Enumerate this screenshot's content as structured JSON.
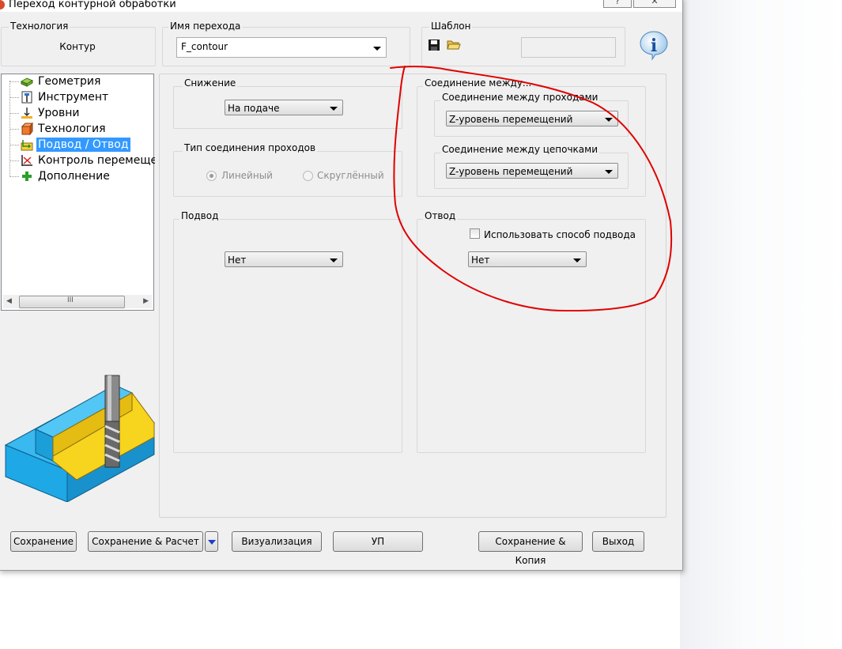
{
  "window": {
    "title": "Переход контурной обработки"
  },
  "header": {
    "technology_label": "Технология",
    "technology_value": "Контур",
    "transition_name_label": "Имя перехода",
    "transition_name_value": "F_contour",
    "template_label": "Шаблон"
  },
  "tree": {
    "items": [
      {
        "label": "Геометрия",
        "icon": "geometry-icon"
      },
      {
        "label": "Инструмент",
        "icon": "tool-icon"
      },
      {
        "label": "Уровни",
        "icon": "levels-icon"
      },
      {
        "label": "Технология",
        "icon": "technology-icon"
      },
      {
        "label": "Подвод / Отвод",
        "icon": "approach-retract-icon",
        "selected": true
      },
      {
        "label": "Контроль перемещен",
        "icon": "movement-control-icon"
      },
      {
        "label": "Дополнение",
        "icon": "add-icon"
      }
    ],
    "scroll_grip": "III"
  },
  "lowering": {
    "title": "Снижение",
    "value": "На подаче"
  },
  "pass_link_type": {
    "title": "Тип соединения проходов",
    "option_linear": "Линейный",
    "option_rounded": "Скруглённый",
    "selected": "Линейный"
  },
  "links": {
    "title": "Соединение между...",
    "between_passes": {
      "title": "Соединение между проходами",
      "value": "Z-уровень перемещений"
    },
    "between_chains": {
      "title": "Соединение между цепочками",
      "value": "Z-уровень перемещений"
    }
  },
  "approach": {
    "title": "Подвод",
    "value": "Нет"
  },
  "retract": {
    "title": "Отвод",
    "use_approach_label": "Использовать способ подвода",
    "value": "Нет"
  },
  "buttons": {
    "save": "Сохранение",
    "save_calc": "Сохранение & Расчет",
    "visualize": "Визуализация",
    "nc": "УП",
    "save_copy": "Сохранение & Копия",
    "exit": "Выход"
  },
  "colors": {
    "selection": "#3399ff",
    "annotation": "#e00000",
    "part_blue": "#1ea8e6",
    "part_yellow": "#f7d41e"
  }
}
